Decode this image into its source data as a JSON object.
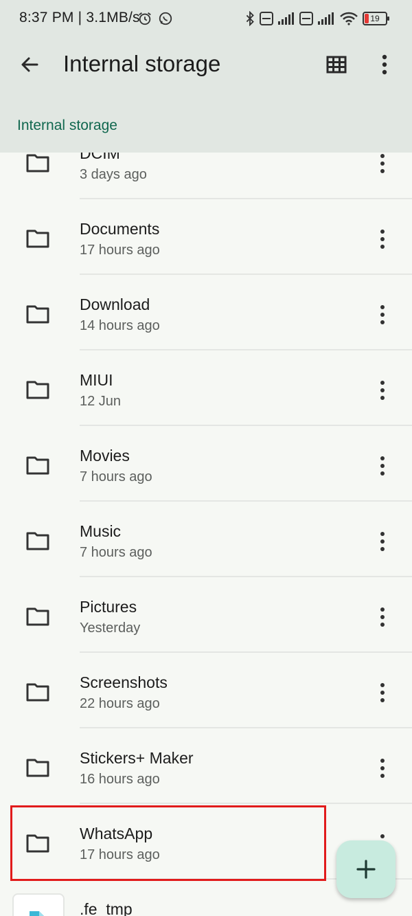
{
  "statusbar": {
    "time": "8:37 PM | 3.1MB/s",
    "battery": "19"
  },
  "toolbar": {
    "title": "Internal storage"
  },
  "breadcrumb": {
    "label": "Internal storage"
  },
  "colors": {
    "header_bg": "#e1e7e2",
    "accent": "#11684f",
    "highlight_border": "#e11b1b",
    "fab_bg": "#c8ebdf"
  },
  "items": [
    {
      "name": "DCIM",
      "date": "3 days ago"
    },
    {
      "name": "Documents",
      "date": "17 hours ago"
    },
    {
      "name": "Download",
      "date": "14 hours ago"
    },
    {
      "name": "MIUI",
      "date": "12 Jun"
    },
    {
      "name": "Movies",
      "date": "7 hours ago"
    },
    {
      "name": "Music",
      "date": "7 hours ago"
    },
    {
      "name": "Pictures",
      "date": "Yesterday"
    },
    {
      "name": "Screenshots",
      "date": "22 hours ago"
    },
    {
      "name": "Stickers+ Maker",
      "date": "16 hours ago"
    },
    {
      "name": "WhatsApp",
      "date": "17 hours ago"
    },
    {
      "name": ".fe_tmp",
      "date": ""
    }
  ]
}
